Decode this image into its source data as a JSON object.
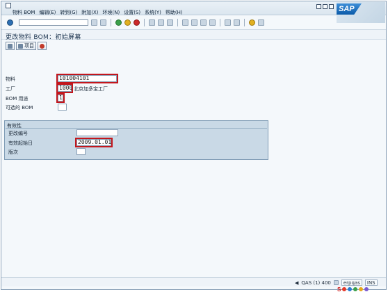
{
  "menubar": {
    "items": [
      "物料 BOM",
      "编辑(E)",
      "转到(G)",
      "附加(X)",
      "环境(N)",
      "设置(S)",
      "系统(Y)",
      "帮助(H)"
    ]
  },
  "logo": {
    "text": "SAP"
  },
  "screen": {
    "title": "更改物料 BOM：初始屏幕"
  },
  "apptoolbar": {
    "item_label": "项目"
  },
  "form": {
    "material": {
      "label": "物料",
      "value": "101004101"
    },
    "plant": {
      "label": "工厂",
      "value": "1000",
      "description": "北京加多宝工厂"
    },
    "bom_usage": {
      "label": "BOM 用途",
      "value": "1"
    },
    "alternative_bom": {
      "label": "可选的 BOM",
      "value": ""
    }
  },
  "effectivity": {
    "title": "有效性",
    "change_number": {
      "label": "更改编号",
      "value": ""
    },
    "valid_from": {
      "label": "有效起始日",
      "value": "2009.01.01"
    },
    "revision_level": {
      "label": "版次",
      "value": ""
    }
  },
  "statusbar": {
    "system": "QAS (1) 400",
    "server": "erpqas",
    "mode": "INS"
  },
  "tray": {
    "brand": "S"
  },
  "colors": {
    "highlight": "#c3161c",
    "group_bg": "#c9d9e6"
  }
}
